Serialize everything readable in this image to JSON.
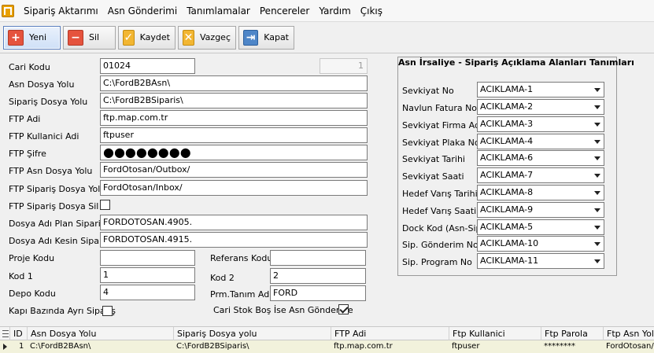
{
  "menu": {
    "items": [
      "Sipariş Aktarımı",
      "Asn Gönderimi",
      "Tanımlamalar",
      "Pencereler",
      "Yardım",
      "Çıkış"
    ]
  },
  "toolbar": {
    "new_label": "Yeni",
    "delete_label": "Sil",
    "save_label": "Kaydet",
    "cancel_label": "Vazgeç",
    "close_label": "Kapat"
  },
  "form": {
    "cari_kodu": {
      "label": "Cari Kodu",
      "value": "01024"
    },
    "record_id": "1",
    "asn_dosya_yolu": {
      "label": "Asn Dosya Yolu",
      "value": "C:\\FordB2BAsn\\"
    },
    "siparis_dosya_yolu": {
      "label": "Sipariş Dosya Yolu",
      "value": "C:\\FordB2BSiparis\\"
    },
    "ftp_adi": {
      "label": "FTP Adi",
      "value": "ftp.map.com.tr"
    },
    "ftp_kullanici": {
      "label": "FTP Kullanici Adi",
      "value": "ftpuser"
    },
    "ftp_sifre": {
      "label": "FTP Şifre",
      "value": "●●●●●●●●"
    },
    "ftp_asn_yolu": {
      "label": "FTP Asn Dosya Yolu",
      "value": "FordOtosan/Outbox/"
    },
    "ftp_siparis_yolu": {
      "label": "FTP Sipariş Dosya Yolu",
      "value": "FordOtosan/Inbox/"
    },
    "ftp_siparis_sil": {
      "label": "FTP Sipariş Dosya Sil",
      "checked": false
    },
    "dosya_plan": {
      "label": "Dosya Adı Plan Siparis",
      "value": "FORDOTOSAN.4905."
    },
    "dosya_kesin": {
      "label": "Dosya Adı Kesin Siparis",
      "value": "FORDOTOSAN.4915."
    },
    "proje_kodu": {
      "label": "Proje Kodu",
      "value": ""
    },
    "referans_kodu": {
      "label": "Referans Kodu",
      "value": ""
    },
    "kod1": {
      "label": "Kod 1",
      "value": "1"
    },
    "kod2": {
      "label": "Kod 2",
      "value": "2"
    },
    "depo_kodu": {
      "label": "Depo Kodu",
      "value": "4"
    },
    "prm_tanim": {
      "label": "Prm.Tanım Adı",
      "value": "FORD"
    },
    "kapi_bazinda": {
      "label": "Kapı Bazında Ayrı Sipariş",
      "checked": false
    },
    "cari_stok": {
      "label": "Cari Stok Boş İse Asn Gönderme",
      "checked": true
    }
  },
  "panel": {
    "title": "Asn İrsaliye - Sipariş Açıklama Alanları Tanımları",
    "rows": [
      {
        "label": "Sevkiyat No",
        "value": "ACIKLAMA-1"
      },
      {
        "label": "Navlun Fatura No",
        "value": "ACIKLAMA-2"
      },
      {
        "label": "Sevkiyat Firma Adı",
        "value": "ACIKLAMA-3"
      },
      {
        "label": "Sevkiyat Plaka No",
        "value": "ACIKLAMA-4"
      },
      {
        "label": "Sevkiyat Tarihi",
        "value": "ACIKLAMA-6"
      },
      {
        "label": "Sevkiyat Saati",
        "value": "ACIKLAMA-7"
      },
      {
        "label": "Hedef Varış Tarihi",
        "value": "ACIKLAMA-8"
      },
      {
        "label": "Hedef Varış Saati",
        "value": "ACIKLAMA-9"
      },
      {
        "label": "Dock Kod (Asn-Sip.)",
        "value": "ACIKLAMA-5"
      },
      {
        "label": "Sip. Gönderim No",
        "value": "ACIKLAMA-10"
      },
      {
        "label": "Sip. Program No",
        "value": "ACIKLAMA-11"
      }
    ]
  },
  "grid": {
    "headers": [
      "ID",
      "Asn Dosya Yolu",
      "Sipariş Dosya yolu",
      "FTP Adi",
      "Ftp Kullanici",
      "Ftp Parola",
      "Ftp Asn Yolu"
    ],
    "row": [
      "1",
      "C:\\FordB2BAsn\\",
      "C:\\FordB2BSiparis\\",
      "ftp.map.com.tr",
      "ftpuser",
      "********",
      "FordOtosan/"
    ]
  }
}
